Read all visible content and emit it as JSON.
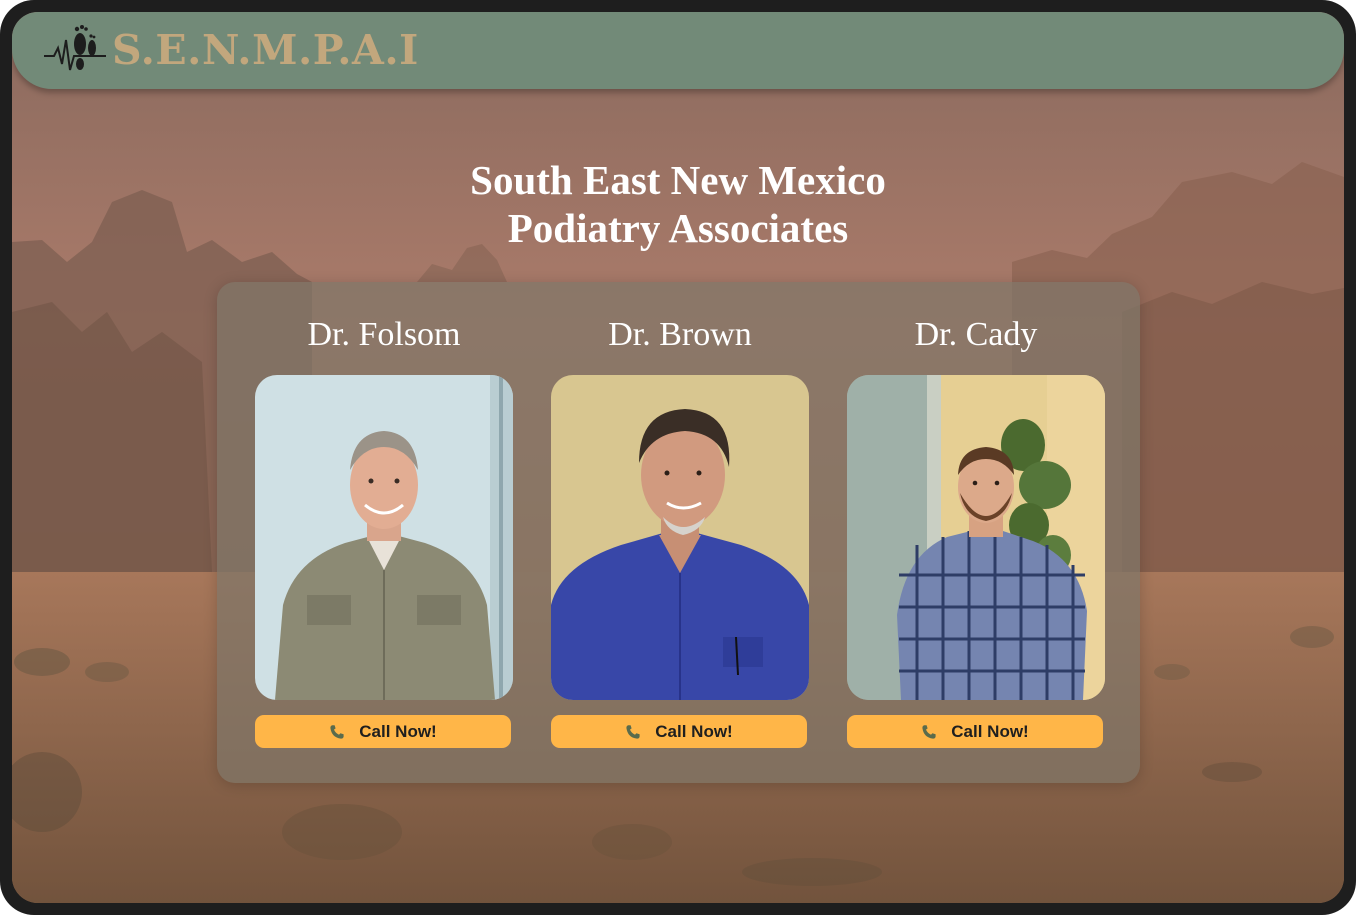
{
  "brand": {
    "logo_text": "S.E.N.M.P.A.I",
    "logo_icon": "footprint-heartbeat-icon",
    "text_color": "#c2a77d",
    "navbar_color": "#728a78"
  },
  "hero": {
    "title_line1": "South East New Mexico",
    "title_line2": "Podiatry Associates"
  },
  "doctors": [
    {
      "name": "Dr. Folsom",
      "button_label": "Call Now!",
      "photo": "portrait of doctor in olive shirt"
    },
    {
      "name": "Dr. Brown",
      "button_label": "Call Now!",
      "photo": "portrait of doctor in blue shirt"
    },
    {
      "name": "Dr. Cady",
      "button_label": "Call Now!",
      "photo": "portrait of doctor in plaid shirt"
    }
  ],
  "colors": {
    "button": "#ffb648",
    "button_text": "#1f1f1f",
    "panel": "rgba(128,118,104,0.72)"
  },
  "icons": {
    "button_icon": "phone-icon"
  }
}
